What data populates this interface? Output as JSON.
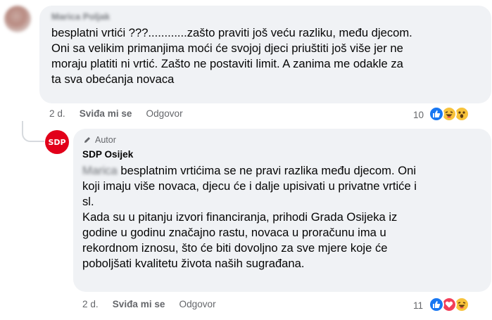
{
  "comment1": {
    "author": "Marica Poljak",
    "lines": [
      "besplatni vrtići ???............zašto praviti još veću razliku, među djecom.",
      "Oni sa velikim primanjima moći će svojoj djeci priuštiti još više jer ne",
      "moraju platiti ni vrtić. Zašto ne postaviti limit. A zanima me odakle za",
      "ta sva obećanja novaca"
    ],
    "time": "2 d.",
    "like_label": "Sviđa mi se",
    "reply_label": "Odgovor",
    "reaction_count": "10",
    "reactions": [
      "like-icon",
      "haha-icon",
      "wow-icon"
    ]
  },
  "reply": {
    "badge": "Autor",
    "author": "SDP Osijek",
    "avatar_text": "SDP",
    "mention": "Marica",
    "first_line_rest": " besplatnim vrtićima se ne pravi razlika među djecom. Oni",
    "lines": [
      "koji imaju više novaca, djecu će i dalje upisivati u privatne vrtiće i",
      "sl.",
      "Kada su u pitanju izvori financiranja, prihodi Grada Osijeka iz",
      "godine u godinu značajno rastu, novaca u proračunu ima u",
      "rekordnom iznosu, što će biti dovoljno za sve mjere koje će",
      "poboljšati kvalitetu života naših sugrađana."
    ],
    "time": "2 d.",
    "like_label": "Sviđa mi se",
    "reply_label": "Odgovor",
    "reaction_count": "11",
    "reactions": [
      "like-icon",
      "love-icon",
      "haha-icon"
    ]
  }
}
